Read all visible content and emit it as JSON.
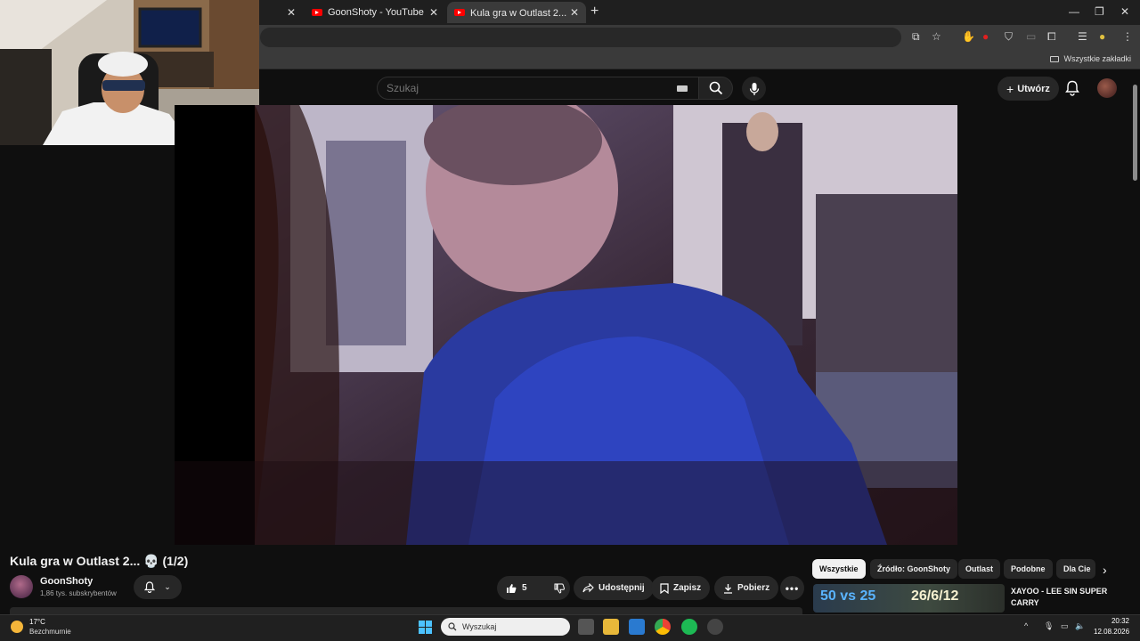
{
  "browser": {
    "tabs": [
      {
        "label": "GoonShoty - YouTube",
        "active": false
      },
      {
        "label": "Kula gra w Outlast 2... 💀 (1/2)",
        "active": true
      }
    ],
    "bookmarks_folder": "Wszystkie zakładki"
  },
  "youtube": {
    "search_placeholder": "Szukaj",
    "create_label": "Utwórz",
    "video_title": "Kula gra w Outlast 2... 💀 (1/2)",
    "channel": {
      "name": "GoonShoty",
      "subscribers": "1,86 tys. subskrybentów"
    },
    "actions": {
      "likes": "5",
      "share": "Udostępnij",
      "save": "Zapisz",
      "download": "Pobierz"
    },
    "chips": [
      "Wszystkie",
      "Źródło: GoonShoty",
      "Outlast",
      "Podobne",
      "Dla Cie"
    ],
    "recommended": {
      "title": "XAYOO - LEE SIN SUPER CARRY",
      "thumb_text_left": "50 vs 25",
      "thumb_text_right": "26/6/12"
    }
  },
  "taskbar": {
    "weather_temp": "17°C",
    "weather_desc": "Bezchmurnie",
    "search_label": "Wyszukaj",
    "time": "20:32",
    "date": "12.08.2026"
  },
  "colors": {
    "youtube_red": "#ff0000",
    "background": "#0f0f0f",
    "pill": "#272727"
  }
}
